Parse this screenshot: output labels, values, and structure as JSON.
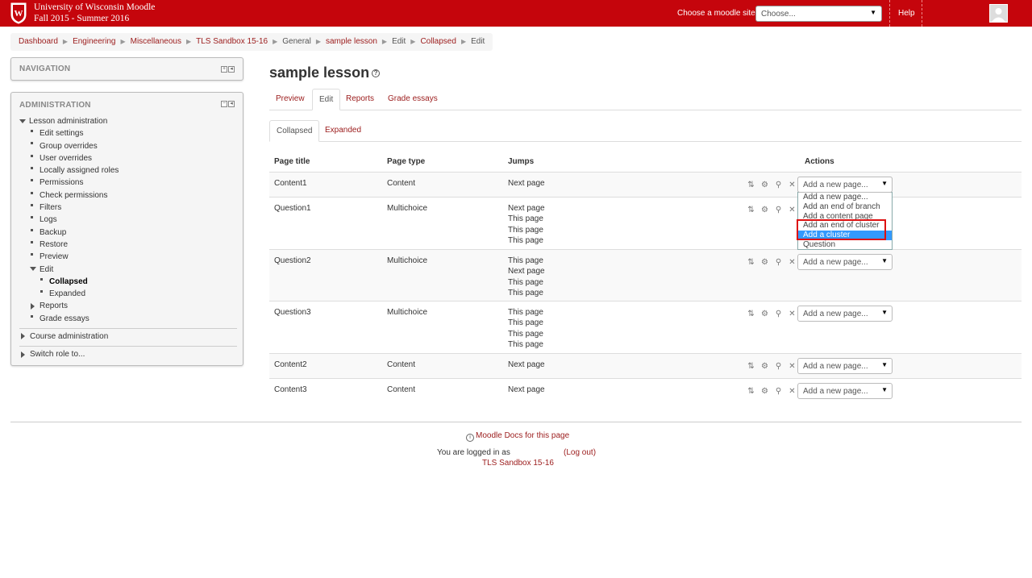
{
  "header": {
    "site_title_line1": "University of Wisconsin Moodle",
    "site_title_line2": "Fall 2015 - Summer 2016",
    "choose_label": "Choose a moodle site:",
    "choose_value": "Choose...",
    "help": "Help",
    "brand_color": "#c5050c"
  },
  "breadcrumb": [
    "Dashboard",
    "Engineering",
    "Miscellaneous",
    "TLS Sandbox 15-16",
    "General",
    "sample lesson",
    "Edit",
    "Collapsed",
    "Edit"
  ],
  "navigation_block": {
    "title": "NAVIGATION"
  },
  "admin_block": {
    "title": "ADMINISTRATION",
    "lesson_admin": "Lesson administration",
    "items": [
      "Edit settings",
      "Group overrides",
      "User overrides",
      "Locally assigned roles",
      "Permissions",
      "Check permissions",
      "Filters",
      "Logs",
      "Backup",
      "Restore",
      "Preview"
    ],
    "edit": "Edit",
    "edit_children": [
      "Collapsed",
      "Expanded"
    ],
    "after_items": [
      "Reports",
      "Grade essays"
    ],
    "course_admin": "Course administration",
    "switch_role": "Switch role to..."
  },
  "main": {
    "heading": "sample lesson",
    "tabs": [
      "Preview",
      "Edit",
      "Reports",
      "Grade essays"
    ],
    "subtabs": [
      "Collapsed",
      "Expanded"
    ],
    "columns": [
      "Page title",
      "Page type",
      "Jumps",
      "Actions"
    ],
    "rows": [
      {
        "title": "Content1",
        "type": "Content",
        "jumps": [
          "Next page"
        ]
      },
      {
        "title": "Question1",
        "type": "Multichoice",
        "jumps": [
          "Next page",
          "This page",
          "This page",
          "This page"
        ]
      },
      {
        "title": "Question2",
        "type": "Multichoice",
        "jumps": [
          "This page",
          "Next page",
          "This page",
          "This page"
        ]
      },
      {
        "title": "Question3",
        "type": "Multichoice",
        "jumps": [
          "This page",
          "This page",
          "This page",
          "This page"
        ]
      },
      {
        "title": "Content2",
        "type": "Content",
        "jumps": [
          "Next page"
        ]
      },
      {
        "title": "Content3",
        "type": "Content",
        "jumps": [
          "Next page"
        ]
      }
    ],
    "add_page_placeholder": "Add a new page...",
    "dropdown_options": [
      "Add a new page...",
      "Add an end of branch",
      "Add a content page",
      "Add an end of cluster",
      "Add a cluster",
      "Question"
    ],
    "dropdown_selected": "Add a cluster"
  },
  "footer": {
    "docs": "Moodle Docs for this page",
    "logged_in": "You are logged in as",
    "logout": "(Log out)",
    "course": "TLS Sandbox 15-16"
  }
}
